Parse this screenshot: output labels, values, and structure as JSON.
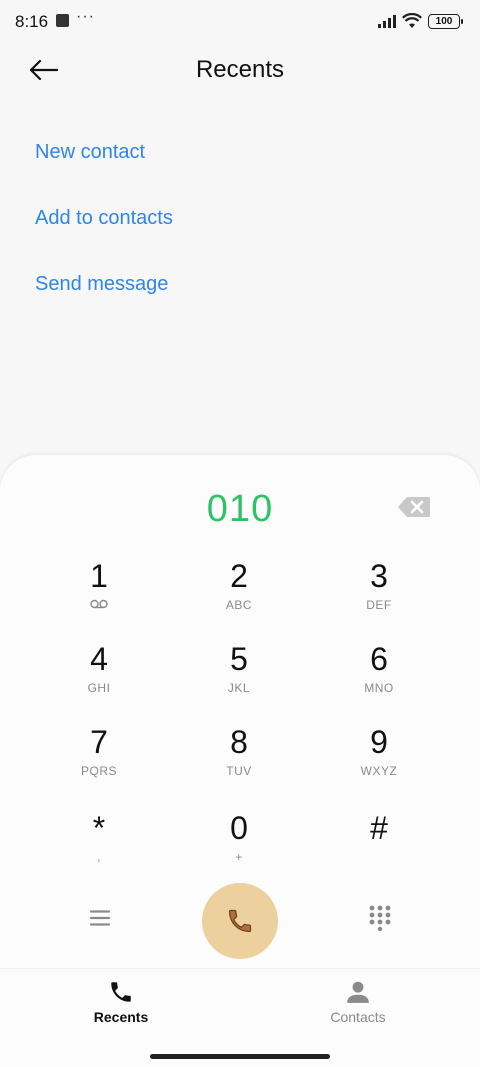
{
  "status_bar": {
    "time": "8:16",
    "dots": "···",
    "battery": "100"
  },
  "header": {
    "title": "Recents"
  },
  "actions": {
    "new_contact": "New contact",
    "add_to_contacts": "Add to contacts",
    "send_message": "Send message"
  },
  "dialer": {
    "number": "010",
    "keys": [
      {
        "digit": "1",
        "letters": ""
      },
      {
        "digit": "2",
        "letters": "ABC"
      },
      {
        "digit": "3",
        "letters": "DEF"
      },
      {
        "digit": "4",
        "letters": "GHI"
      },
      {
        "digit": "5",
        "letters": "JKL"
      },
      {
        "digit": "6",
        "letters": "MNO"
      },
      {
        "digit": "7",
        "letters": "PQRS"
      },
      {
        "digit": "8",
        "letters": "TUV"
      },
      {
        "digit": "9",
        "letters": "WXYZ"
      },
      {
        "digit": "*",
        "letters": ","
      },
      {
        "digit": "0",
        "letters": "+"
      },
      {
        "digit": "#",
        "letters": ""
      }
    ]
  },
  "bottom_nav": {
    "recents": "Recents",
    "contacts": "Contacts"
  },
  "colors": {
    "accent_link": "#2f85e8",
    "number_green": "#2ec265",
    "call_button": "#ecd19e"
  }
}
